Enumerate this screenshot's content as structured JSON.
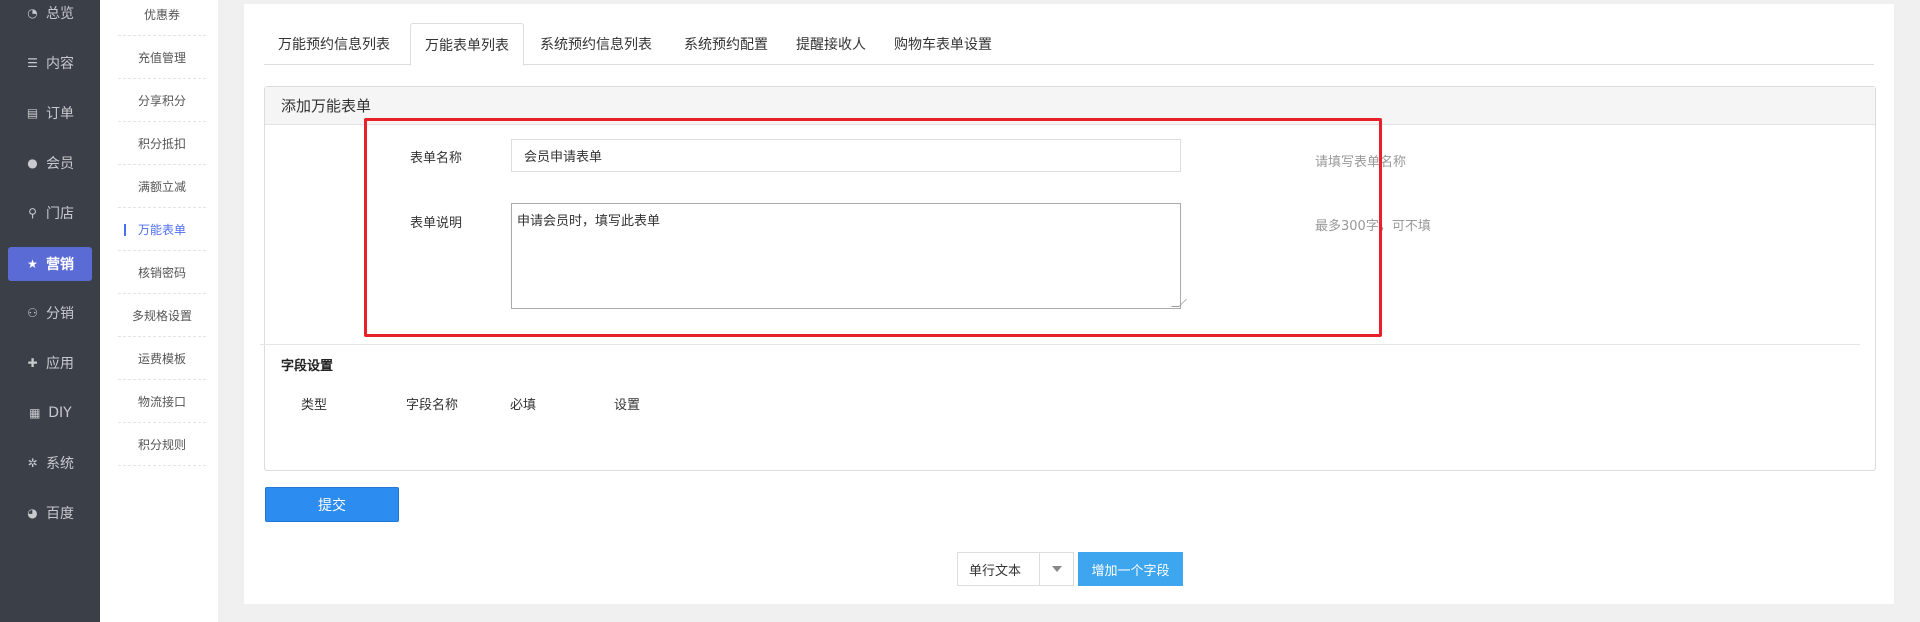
{
  "nav": {
    "items": [
      {
        "label": "总览",
        "icon": "dashboard-icon",
        "glyph": "◔"
      },
      {
        "label": "内容",
        "icon": "list-icon",
        "glyph": "☰"
      },
      {
        "label": "订单",
        "icon": "document-icon",
        "glyph": "▤"
      },
      {
        "label": "会员",
        "icon": "user-icon",
        "glyph": "●"
      },
      {
        "label": "门店",
        "icon": "map-pin-icon",
        "glyph": "⚲"
      },
      {
        "label": "营销",
        "icon": "star-icon",
        "glyph": "★",
        "active": true
      },
      {
        "label": "分销",
        "icon": "users-icon",
        "glyph": "⚇"
      },
      {
        "label": "应用",
        "icon": "puzzle-icon",
        "glyph": "✚"
      },
      {
        "label": "DIY",
        "icon": "layout-icon",
        "glyph": "▦"
      },
      {
        "label": "系统",
        "icon": "gear-icon",
        "glyph": "✲"
      },
      {
        "label": "百度",
        "icon": "baidu-icon",
        "glyph": "◕"
      }
    ]
  },
  "subnav": {
    "items": [
      "优惠券",
      "充值管理",
      "分享积分",
      "积分抵扣",
      "满额立减",
      "万能表单",
      "核销密码",
      "多规格设置",
      "运费模板",
      "物流接口",
      "积分规则"
    ],
    "active_index": 5
  },
  "tabs": [
    "万能预约信息列表",
    "万能表单列表",
    "系统预约信息列表",
    "系统预约配置",
    "提醒接收人",
    "购物车表单设置"
  ],
  "panel": {
    "title": "添加万能表单",
    "form": {
      "name_label": "表单名称",
      "name_value": "会员申请表单",
      "name_hint": "请填写表单名称",
      "desc_label": "表单说明",
      "desc_value": "申请会员时，填写此表单",
      "desc_hint": "最多300字，可不填"
    },
    "fields": {
      "title": "字段设置",
      "columns": [
        "类型",
        "字段名称",
        "必填",
        "设置"
      ]
    }
  },
  "submit_label": "提交",
  "field_type": {
    "selected": "单行文本",
    "add_label": "增加一个字段"
  },
  "colors": {
    "nav_bg": "#3b3f47",
    "nav_active": "#5a6bd6",
    "primary": "#2d8cf0",
    "add_button": "#3ea5ef",
    "highlight": "#e8202a"
  }
}
